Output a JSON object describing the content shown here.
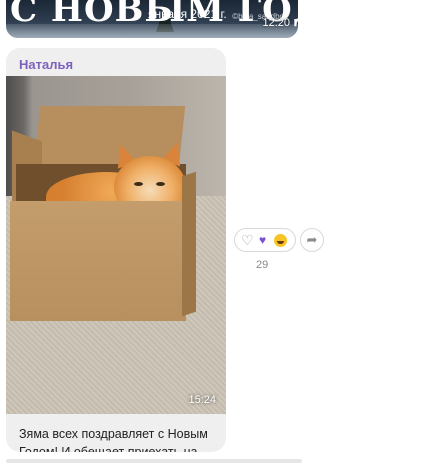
{
  "top_message": {
    "headline": "С НОВЫМ ГОДОМ",
    "date_text": "января 2021 г.",
    "time": "12:20",
    "watermark": "©bina_sandbox"
  },
  "message": {
    "sender": "Наталья",
    "photo_time": "15:24",
    "caption": "Зяма всех поздравляет с Новым Годом! И обещает приехать на дачу весной. Готовьтесь..."
  },
  "reactions": {
    "count": "29",
    "icons": [
      "heart-outline-icon",
      "purple-heart-icon",
      "laughing-emoji-icon",
      "share-icon"
    ]
  },
  "colors": {
    "sender": "#7e61bd",
    "bubble": "#efefef",
    "purple_heart": "#7a4fd1"
  }
}
